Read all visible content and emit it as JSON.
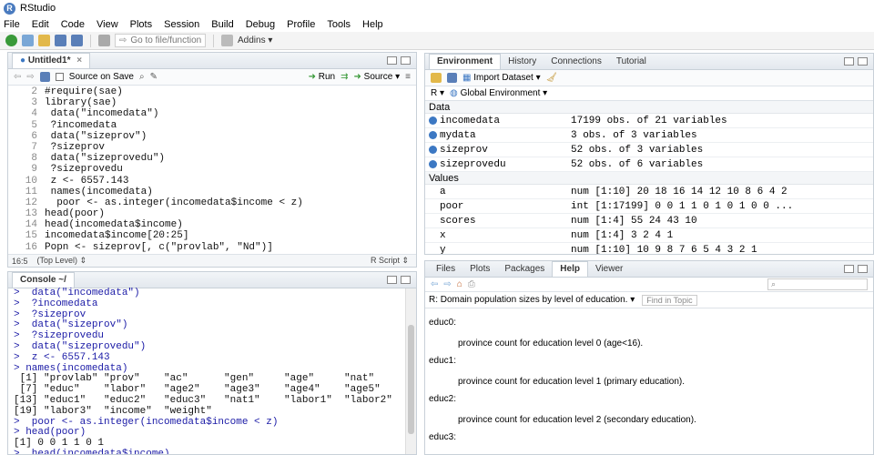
{
  "window": {
    "title": "RStudio"
  },
  "menu": [
    "File",
    "Edit",
    "Code",
    "View",
    "Plots",
    "Session",
    "Build",
    "Debug",
    "Profile",
    "Tools",
    "Help"
  ],
  "toolbar": {
    "goto_placeholder": "Go to file/function",
    "addins": "Addins"
  },
  "editor": {
    "tab": "Untitled1*",
    "source_on_save": "Source on Save",
    "run": "Run",
    "source": "Source",
    "lines": [
      {
        "n": "2",
        "code": "#require(sae)"
      },
      {
        "n": "3",
        "code": "library(sae)"
      },
      {
        "n": "4",
        "code": " data(\"incomedata\")"
      },
      {
        "n": "5",
        "code": " ?incomedata"
      },
      {
        "n": "6",
        "code": " data(\"sizeprov\")"
      },
      {
        "n": "7",
        "code": " ?sizeprov"
      },
      {
        "n": "8",
        "code": " data(\"sizeprovedu\")"
      },
      {
        "n": "9",
        "code": " ?sizeprovedu"
      },
      {
        "n": "10",
        "code": " z <- 6557.143"
      },
      {
        "n": "11",
        "code": " names(incomedata)"
      },
      {
        "n": "12",
        "code": "  poor <- as.integer(incomedata$income < z)"
      },
      {
        "n": "13",
        "code": "head(poor)"
      },
      {
        "n": "14",
        "code": "head(incomedata$income)"
      },
      {
        "n": "15",
        "code": "incomedata$income[20:25]"
      },
      {
        "n": "16",
        "code": "Popn <- sizeprov[, c(\"provlab\", \"Nd\")]"
      }
    ],
    "status_pos": "16:5",
    "status_level": "(Top Level)",
    "status_type": "R Script"
  },
  "console": {
    "tab": "Console ~/",
    "lines": [
      {
        "t": "cmd",
        "text": ">  data(\"incomedata\")"
      },
      {
        "t": "cmd",
        "text": ">  ?incomedata"
      },
      {
        "t": "cmd",
        "text": ">  ?sizeprov"
      },
      {
        "t": "cmd",
        "text": ">  data(\"sizeprov\")"
      },
      {
        "t": "cmd",
        "text": ">  ?sizeprovedu"
      },
      {
        "t": "cmd",
        "text": ">  data(\"sizeprovedu\")"
      },
      {
        "t": "cmd",
        "text": ">  z <- 6557.143"
      },
      {
        "t": "cmd",
        "text": "> names(incomedata)"
      },
      {
        "t": "out",
        "text": " [1] \"provlab\" \"prov\"    \"ac\"      \"gen\"     \"age\"     \"nat\""
      },
      {
        "t": "out",
        "text": " [7] \"educ\"    \"labor\"   \"age2\"    \"age3\"    \"age4\"    \"age5\""
      },
      {
        "t": "out",
        "text": "[13] \"educ1\"   \"educ2\"   \"educ3\"   \"nat1\"    \"labor1\"  \"labor2\""
      },
      {
        "t": "out",
        "text": "[19] \"labor3\"  \"income\"  \"weight\""
      },
      {
        "t": "cmd",
        "text": ">  poor <- as.integer(incomedata$income < z)"
      },
      {
        "t": "cmd",
        "text": "> head(poor)"
      },
      {
        "t": "out",
        "text": "[1] 0 0 1 1 0 1"
      },
      {
        "t": "cmd",
        "text": ">  head(incomedata$income)"
      }
    ]
  },
  "environment": {
    "tabs": [
      "Environment",
      "History",
      "Connections",
      "Tutorial"
    ],
    "import_dataset": "Import Dataset",
    "lang": "R",
    "scope": "Global Environment",
    "data_heading": "Data",
    "values_heading": "Values",
    "data": [
      {
        "name": "incomedata",
        "value": "17199 obs. of 21 variables"
      },
      {
        "name": "mydata",
        "value": "3 obs. of 3 variables"
      },
      {
        "name": "sizeprov",
        "value": "52 obs. of 3 variables"
      },
      {
        "name": "sizeprovedu",
        "value": "52 obs. of 6 variables"
      }
    ],
    "values": [
      {
        "name": "a",
        "value": "num [1:10] 20 18 16 14 12 10 8 6 4 2"
      },
      {
        "name": "poor",
        "value": "int [1:17199] 0 0 1 1 0 1 0 1 0 0 ..."
      },
      {
        "name": "scores",
        "value": "num [1:4] 55 24 43 10"
      },
      {
        "name": "x",
        "value": "num [1:4] 3 2 4 1"
      },
      {
        "name": "y",
        "value": "num [1:10] 10 9 8 7 6 5 4 3 2 1"
      }
    ]
  },
  "help": {
    "tabs": [
      "Files",
      "Plots",
      "Packages",
      "Help",
      "Viewer"
    ],
    "title": "R: Domain population sizes by level of education.",
    "find_topic": "Find in Topic",
    "entries": [
      {
        "term": "educ0:",
        "desc": "province count for education level 0 (age<16)."
      },
      {
        "term": "educ1:",
        "desc": "province count for education level 1 (primary education)."
      },
      {
        "term": "educ2:",
        "desc": "province count for education level 2 (secondary education)."
      },
      {
        "term": "educ3:",
        "desc": ""
      }
    ]
  }
}
